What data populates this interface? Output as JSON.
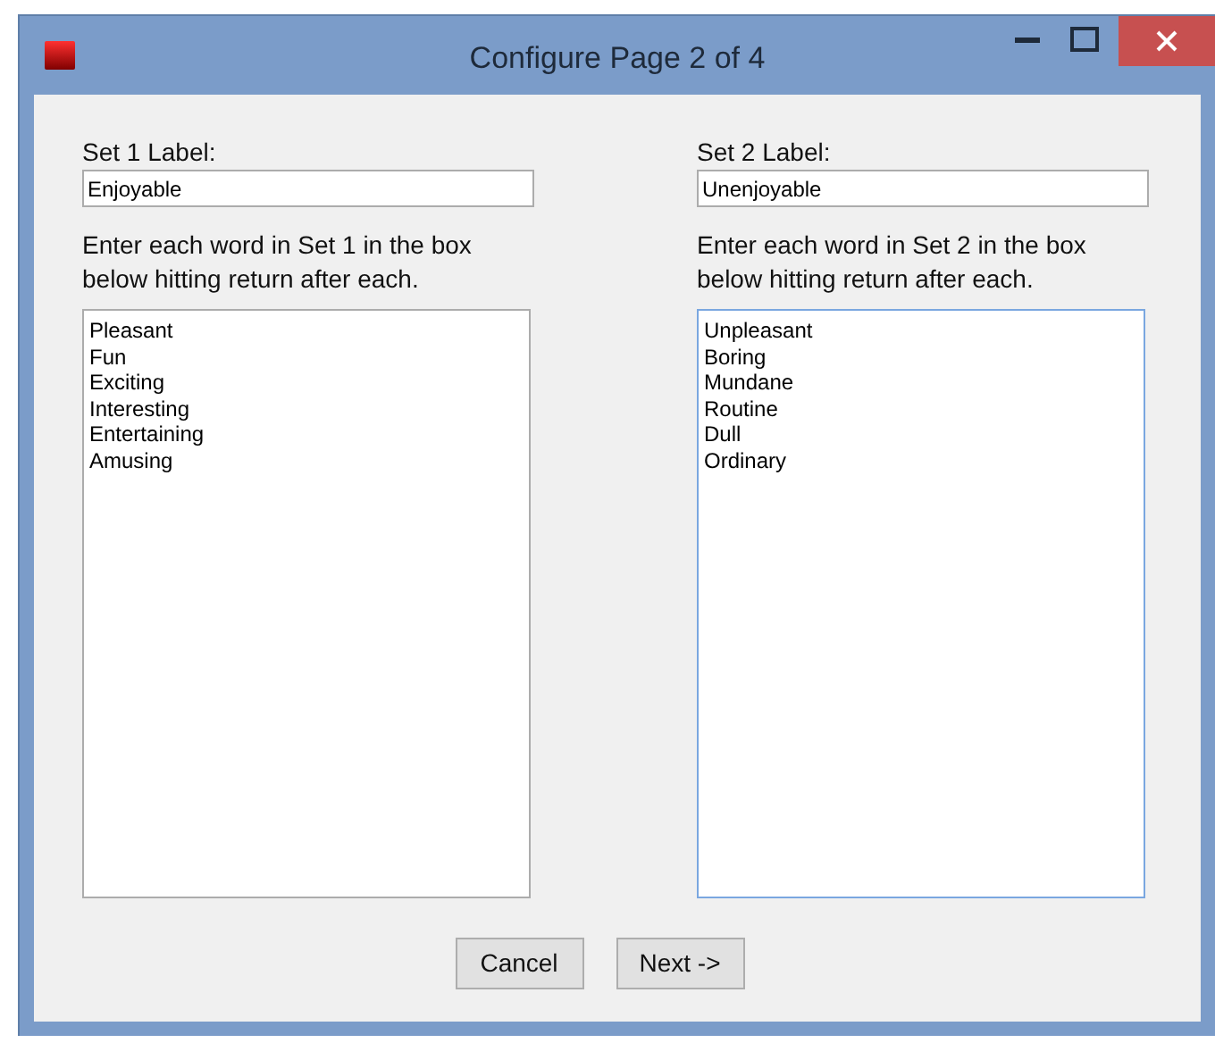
{
  "window": {
    "title": "Configure Page 2 of 4"
  },
  "sets": [
    {
      "label": "Set 1 Label:",
      "value": "Enjoyable",
      "instructions": "Enter each word in Set 1 in the box below hitting return after each.",
      "focused": false,
      "words": [
        "Pleasant",
        "Fun",
        "Exciting",
        "Interesting",
        "Entertaining",
        "Amusing"
      ]
    },
    {
      "label": "Set 2 Label:",
      "value": "Unenjoyable",
      "instructions": "Enter each word in Set 2 in the box below hitting return after each.",
      "focused": true,
      "words": [
        "Unpleasant",
        "Boring",
        "Mundane",
        "Routine",
        "Dull",
        "Ordinary"
      ]
    }
  ],
  "buttons": [
    "Cancel",
    "Next ->"
  ]
}
